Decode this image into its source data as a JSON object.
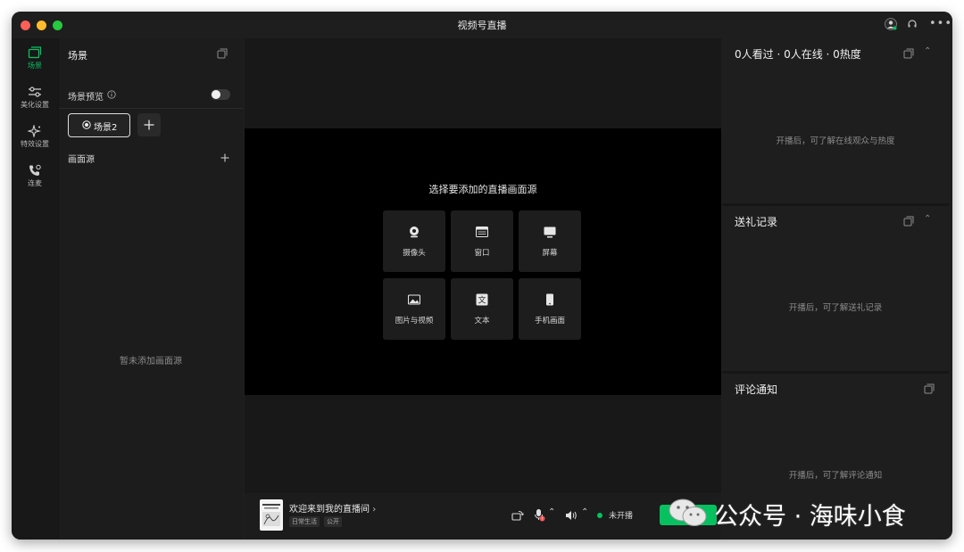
{
  "window": {
    "title": "视频号直播"
  },
  "rail": [
    {
      "label": "场景",
      "icon": "scene-icon"
    },
    {
      "label": "美化设置",
      "icon": "sliders-icon"
    },
    {
      "label": "特效设置",
      "icon": "sparkle-icon"
    },
    {
      "label": "连麦",
      "icon": "phone-icon"
    }
  ],
  "scene": {
    "title": "场景",
    "preview_label": "场景预览",
    "active_scene": "场景2",
    "sources_title": "画面源",
    "empty_text": "暂未添加画面源"
  },
  "stage": {
    "prompt": "选择要添加的直播画面源",
    "sources": [
      {
        "label": "摄像头",
        "icon": "camera-icon"
      },
      {
        "label": "窗口",
        "icon": "window-icon"
      },
      {
        "label": "屏幕",
        "icon": "monitor-icon"
      },
      {
        "label": "图片与视频",
        "icon": "image-icon"
      },
      {
        "label": "文本",
        "icon": "text-icon"
      },
      {
        "label": "手机画面",
        "icon": "phone-screen-icon"
      }
    ]
  },
  "bottom": {
    "room_title": "欢迎来到我的直播间",
    "tags": [
      "日常生活",
      "公开"
    ],
    "status": "未开播",
    "status_color": "#07c160"
  },
  "right": {
    "stats": "0人看过 · 0人在线 · 0热度",
    "stats_hint": "开播后，可了解在线观众与热度",
    "gifts_title": "送礼记录",
    "gifts_hint": "开播后，可了解送礼记录",
    "comments_title": "评论通知",
    "comments_hint": "开播后，可了解评论通知"
  },
  "watermark": {
    "text": "公众号 · 海味小食"
  }
}
